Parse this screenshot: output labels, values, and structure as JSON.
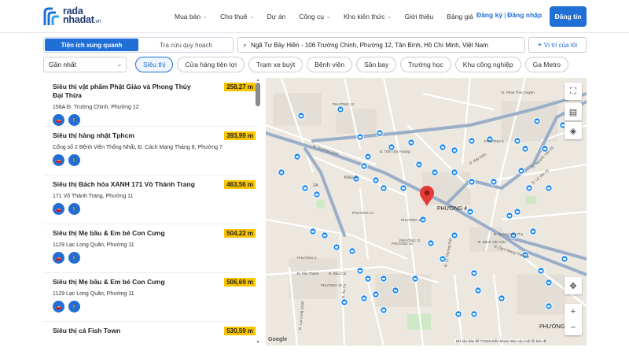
{
  "header": {
    "logo_line1": "rada",
    "logo_line2": "nhadat",
    "logo_suffix": ".vn",
    "nav": [
      {
        "label": "Mua bán",
        "dropdown": true
      },
      {
        "label": "Cho thuê",
        "dropdown": true
      },
      {
        "label": "Dự án",
        "dropdown": false
      },
      {
        "label": "Công cụ",
        "dropdown": true
      },
      {
        "label": "Kho kiến thức",
        "dropdown": true
      },
      {
        "label": "Giới thiệu",
        "dropdown": false
      },
      {
        "label": "Bảng giá",
        "dropdown": false
      }
    ],
    "register": "Đăng ký",
    "login": "Đăng nhập",
    "post_button": "Đăng tin"
  },
  "toolbar": {
    "tabs": [
      "Tiện ích xung quanh",
      "Tra cứu quy hoạch"
    ],
    "active_tab": 0,
    "address": "Ngã Tư Bảy Hiền - 106 Trường Chinh, Phường 12, Tân Bình, Hồ Chí Minh, Việt Nam",
    "location_button": "Vị trí của tôi"
  },
  "filters": {
    "sort": "Gần nhất",
    "chips": [
      "Siêu thị",
      "Cửa hàng tiện lợi",
      "Trạm xe buýt",
      "Bệnh viện",
      "Sân bay",
      "Trường học",
      "Khu công nghiệp",
      "Ga Metro"
    ],
    "active_chip": 0
  },
  "results": [
    {
      "name": "Siêu thị vật phẩm Phật Giáo và Phong Thủy Đại Thừa",
      "distance": "258,27 m",
      "address": "158A Đ. Trường Chinh, Phường 12"
    },
    {
      "name": "Siêu thị hàng nhật Tphcm",
      "distance": "393,99 m",
      "address": "Cổng số 2 Bệnh Viện Thống Nhất, Đ. Cách Mạng Tháng 8, Phường 7"
    },
    {
      "name": "Siêu thị Bách hóa XANH 171 Võ Thành Trang",
      "distance": "463,56 m",
      "address": "171 Võ Thành Trang, Phường 11"
    },
    {
      "name": "Siêu thị Mẹ bầu & Em bé Con Cưng",
      "distance": "504,22 m",
      "address": "1129 Lạc Long Quân, Phường 11"
    },
    {
      "name": "Siêu thị Mẹ bầu & Em bé Con Cưng",
      "distance": "506,69 m",
      "address": "1129 Lạc Long Quân, Phường 11"
    },
    {
      "name": "Siêu thị cá Fish Town",
      "distance": "530,59 m",
      "address": ""
    }
  ],
  "map": {
    "wards": [
      "PHƯỜNG 4",
      "PHƯỜNG 12",
      "PHƯỜNG 13",
      "PHƯỜNG 14",
      "PHƯỜNG 11",
      "PHƯỜNG 10",
      "PHƯỜNG 15",
      "PHƯỜNG 2",
      "PHƯỜNG 5",
      "PHƯỜNG",
      "KHU 3",
      "2A"
    ],
    "streets": [
      "Đ. Trường Chinh",
      "Đ. Cách Mạng Tháng 8",
      "Đ. Lạc Long Quân",
      "Đ. Âu Cơ",
      "Đ. Hoàng Văn Thụ",
      "Đ. Phan Thúc Duyện",
      "Đ. Lý Thường Kiệt",
      "Đ. Nguyễn Văn Vỹ",
      "Đ. Bàu Cát",
      "Đ. Tân Thành",
      "Đ. Bảy Hiền",
      "Đ. Lê Văn Sỹ",
      "Đ. Bành Văn Trân",
      "Đ. Trần Văn Hoàng"
    ],
    "attribution": "Dữ liệu bản đồ ©2025  Điều khoản  Báo cáo một lỗi bản đồ",
    "google": "Google",
    "zoom_in": "+",
    "zoom_out": "−"
  },
  "colors": {
    "accent": "#1f6fd6",
    "distance_badge": "#f9c400",
    "marker_primary": "#e53935",
    "poi_marker": "#1f8bf0"
  }
}
